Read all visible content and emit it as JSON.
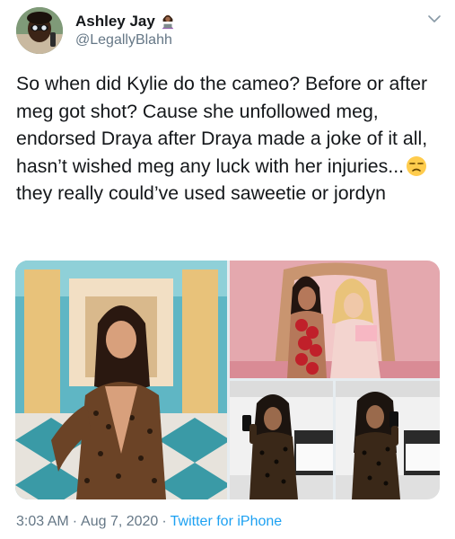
{
  "author": {
    "display_name": "Ashley Jay",
    "handle": "@LegallyBlahh",
    "name_emoji": "woman-technologist-emoji"
  },
  "tweet": {
    "text_before_emoji": "So when did Kylie do the cameo? Before or after meg got shot? Cause she unfollowed meg, endorsed Draya after Draya made a joke of it all, hasn’t wished meg any luck with her injuries...",
    "inline_emoji": "unamused-face-emoji",
    "text_after_emoji": "they really could’ve used saweetie or jordyn"
  },
  "media": [
    {
      "name": "photo-kylie-cameo"
    },
    {
      "name": "photo-two-women-pink-set"
    },
    {
      "name": "photo-mirror-selfie-1"
    },
    {
      "name": "photo-mirror-selfie-2"
    }
  ],
  "meta": {
    "time": "3:03 AM",
    "date": "Aug 7, 2020",
    "separator": "·",
    "source": "Twitter for iPhone"
  },
  "colors": {
    "text": "#14171a",
    "secondary": "#657786",
    "link": "#1da1f2"
  }
}
